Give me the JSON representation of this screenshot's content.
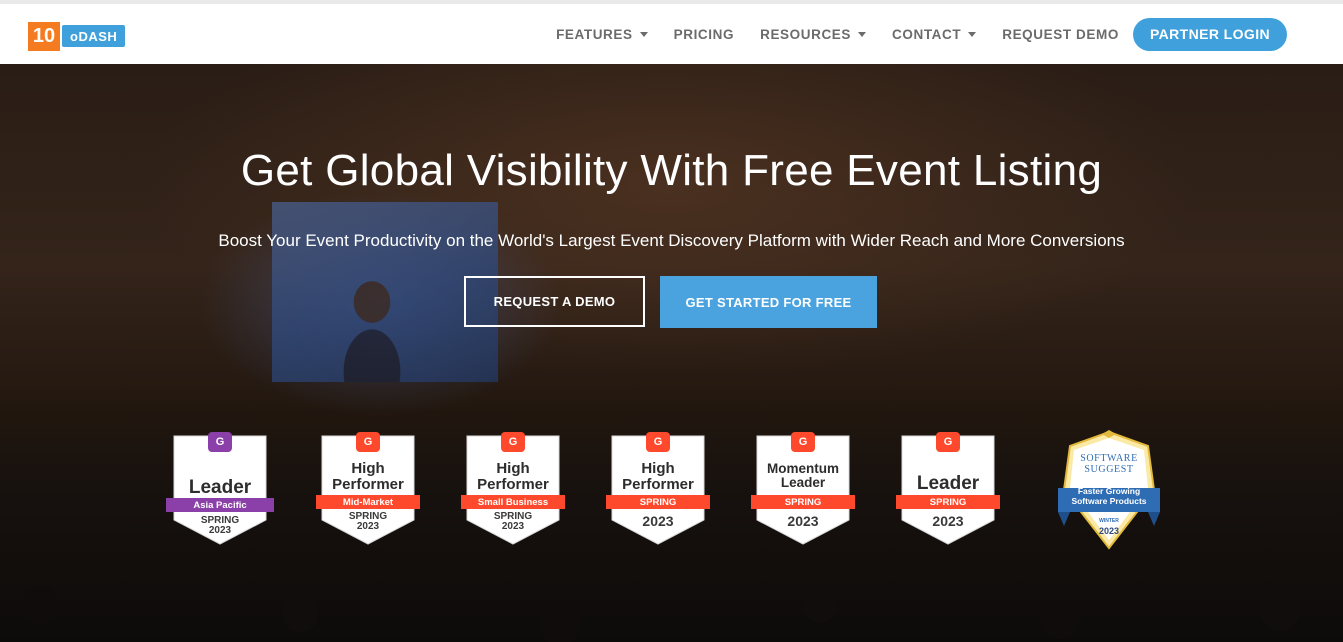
{
  "nav": {
    "logo_number": "10",
    "logo_text": "oDASH",
    "items": [
      {
        "label": "FEATURES",
        "dropdown": true
      },
      {
        "label": "PRICING",
        "dropdown": false
      },
      {
        "label": "RESOURCES",
        "dropdown": true
      },
      {
        "label": "CONTACT",
        "dropdown": true
      },
      {
        "label": "REQUEST DEMO",
        "dropdown": false
      }
    ],
    "partner_login": "PARTNER LOGIN"
  },
  "hero": {
    "title": "Get Global Visibility With Free Event Listing",
    "subtitle": "Boost Your Event Productivity on the World's Largest Event Discovery Platform with Wider Reach and More Conversions",
    "btn_demo": "REQUEST A DEMO",
    "btn_free": "GET STARTED FOR FREE"
  },
  "badges": [
    {
      "title": "Leader",
      "ribbon": "Asia Pacific",
      "season": "SPRING",
      "year": "2023",
      "icon_color": "#8b3fa8",
      "ribbon_color": "#8b3fa8"
    },
    {
      "title": "High Performer",
      "ribbon": "Mid-Market",
      "season": "SPRING",
      "year": "2023",
      "icon_color": "#ff492c",
      "ribbon_color": "#ff492c"
    },
    {
      "title": "High Performer",
      "ribbon": "Small Business",
      "season": "SPRING",
      "year": "2023",
      "icon_color": "#ff492c",
      "ribbon_color": "#ff492c"
    },
    {
      "title": "High Performer",
      "ribbon": "SPRING",
      "season": "",
      "year": "2023",
      "icon_color": "#ff492c",
      "ribbon_color": "#ff492c"
    },
    {
      "title": "Momentum Leader",
      "ribbon": "SPRING",
      "season": "",
      "year": "2023",
      "icon_color": "#ff492c",
      "ribbon_color": "#ff492c"
    },
    {
      "title": "Leader",
      "ribbon": "SPRING",
      "season": "",
      "year": "2023",
      "icon_color": "#ff492c",
      "ribbon_color": "#ff492c"
    }
  ],
  "software_suggest": {
    "logo_line1": "SOFTWARE",
    "logo_line2": "SUGGEST",
    "text": "Faster Growing Software Products",
    "season": "WINTER",
    "year": "2023"
  },
  "colors": {
    "accent": "#3fa0dc",
    "logo_orange": "#f47b20",
    "g2_red": "#ff492c",
    "g2_purple": "#8b3fa8"
  }
}
